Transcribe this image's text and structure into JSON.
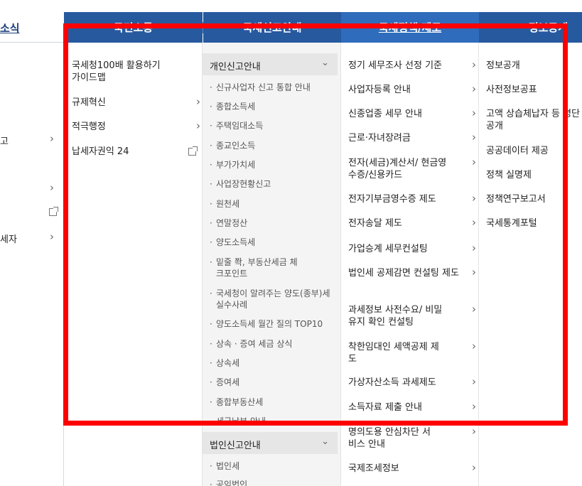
{
  "top_nav": {
    "left_label": "소식",
    "tabs": [
      "국민소통",
      "국세신고안내",
      "국세정책/제도",
      "정보공개"
    ]
  },
  "left_column": {
    "item_a": "고",
    "item_b": "세자"
  },
  "column1": {
    "items": [
      "국세청100배 활용하기 가이드맵",
      "규제혁신",
      "적극행정",
      "납세자권익 24"
    ]
  },
  "column2": {
    "group1_title": "개인신고안내",
    "group1_items": [
      "신규사업자 신고 통합 안내",
      "종합소득세",
      "주택임대소득",
      "종교인소득",
      "부가가치세",
      "사업장현황신고",
      "원천세",
      "연말정산",
      "양도소득세",
      "밑줄 쫙, 부동산세금 체크포인트",
      "국세청이 알려주는 양도(종부)세 실수사례",
      "양도소득세 월간 질의 TOP10",
      "상속 · 증여 세금 상식",
      "상속세",
      "증여세",
      "종합부동산세",
      "세금납부 안내"
    ],
    "group2_title": "법인신고안내",
    "group2_items": [
      "법인세",
      "공익법인"
    ]
  },
  "column3": {
    "items": [
      "정기 세무조사 선정 기준",
      "사업자등록 안내",
      "신종업종 세무 안내",
      "근로·자녀장려금",
      "전자(세금)계산서/ 현금영수증/신용카드",
      "전자기부금영수증 제도",
      "전자송달 제도",
      "가업승계 세무컨설팅",
      "법인세 공제감면 컨설팅 제도",
      "과세정보 사전수요/ 비밀유지 확인 컨설팅",
      "착한임대인 세액공제 제도",
      "가상자산소득 과세제도",
      "소득자료 제출 안내",
      "명의도용 안심차단 서비스 안내",
      "국제조세정보"
    ]
  },
  "column4": {
    "items": [
      "정보공개",
      "사전정보공표",
      "고액 상습체납자 등 명단공개",
      "공공데이터 제공",
      "정책 실명제",
      "정책연구보고서",
      "국세통계포털"
    ]
  },
  "colors": {
    "nav_blue": "#27599f",
    "nav_active": "#2f6cbc",
    "highlight": "#ff0000"
  }
}
